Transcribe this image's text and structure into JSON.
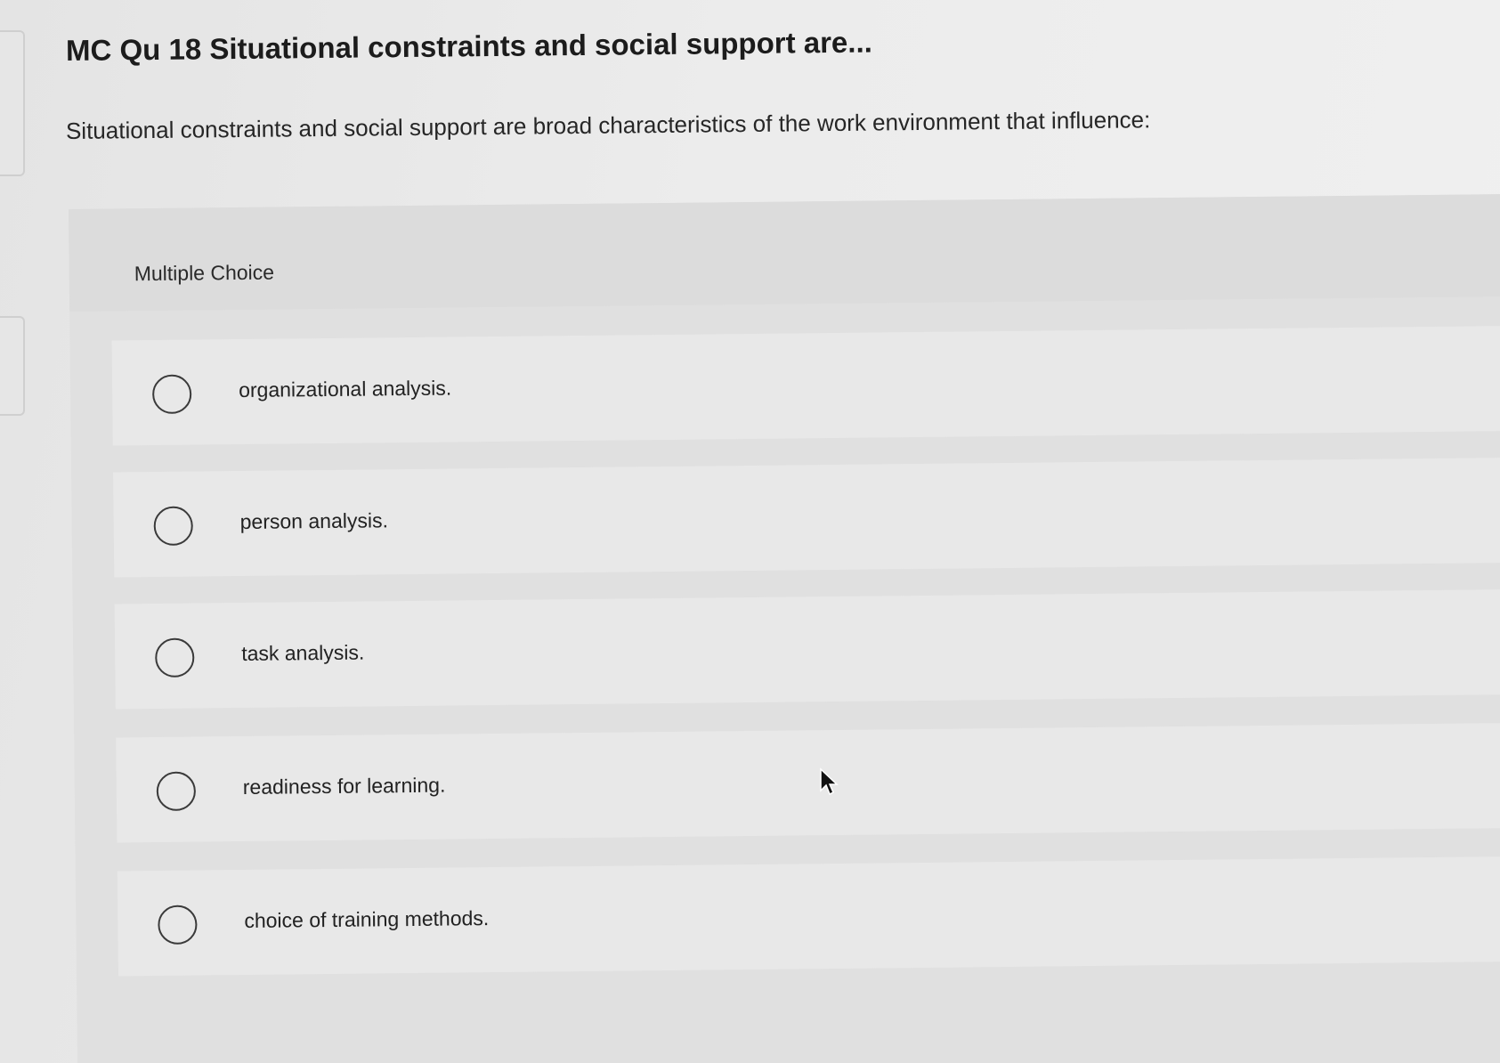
{
  "question": {
    "title": "MC Qu 18 Situational constraints and social support are...",
    "prompt": "Situational constraints and social support are broad characteristics of the work environment that influence:"
  },
  "multiple_choice": {
    "label": "Multiple Choice",
    "options": [
      {
        "text": "organizational analysis.",
        "selected": false
      },
      {
        "text": "person analysis.",
        "selected": false
      },
      {
        "text": "task analysis.",
        "selected": false
      },
      {
        "text": "readiness for learning.",
        "selected": false
      },
      {
        "text": "choice of training methods.",
        "selected": false
      }
    ]
  },
  "icons": {
    "radio": "radio-unselected-icon",
    "cursor": "mouse-pointer-icon"
  }
}
